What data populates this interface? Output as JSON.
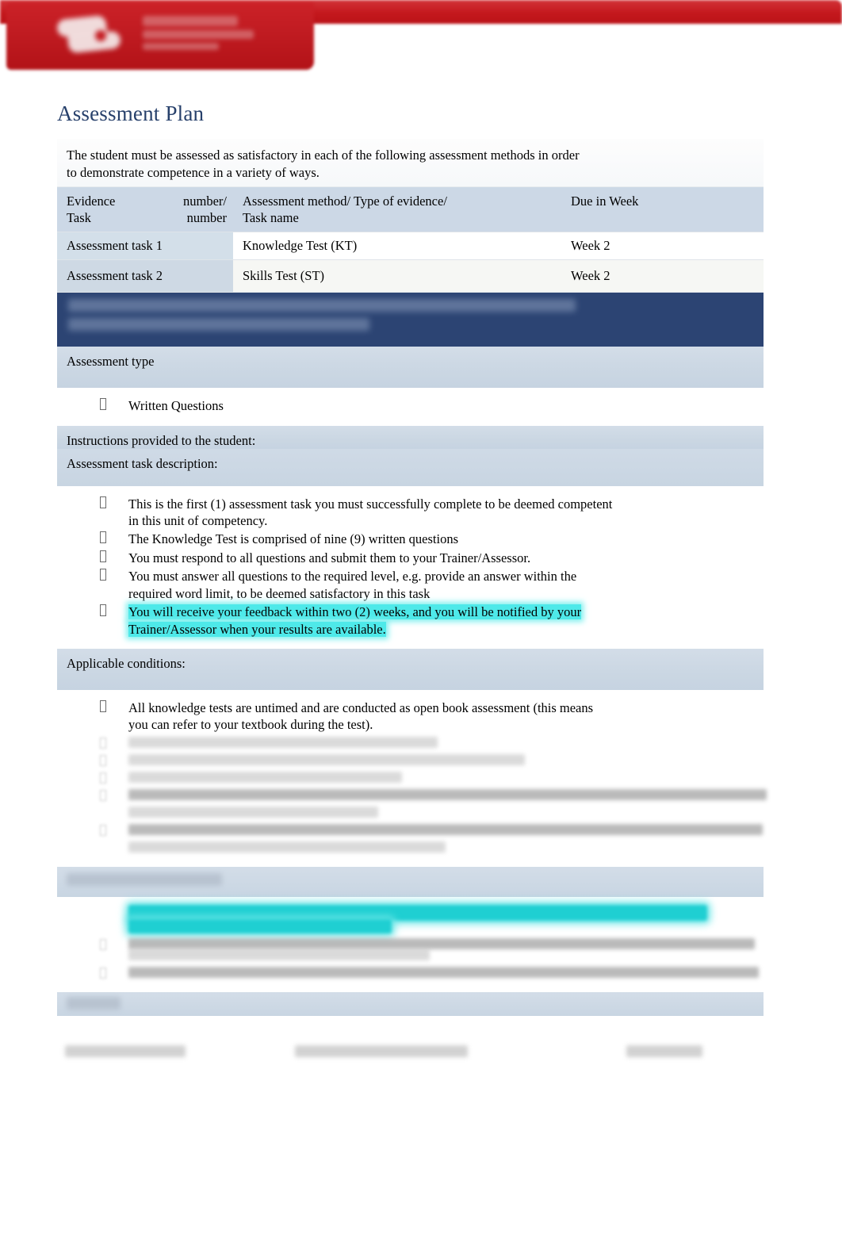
{
  "header": {
    "banner_color": "#c4181d",
    "logo_name": "institution-logo-redacted"
  },
  "page_title": "Assessment Plan",
  "title_color": "#27406b",
  "intro": {
    "line1": "The student must be assessed as satisfactory in each of the following assessment methods in order",
    "line2": "to demonstrate competence in a variety of ways."
  },
  "plan_table": {
    "headers": [
      "Evidence number/ Task number",
      "Assessment method/ Type of evidence/ Task name",
      "Due in Week"
    ],
    "header_parts": {
      "c1_a": "Evidence",
      "c1_b": "number/",
      "c1_c": "Task number",
      "c2_a": "Assessment  method/  Type  of  evidence/",
      "c2_b": "Task name",
      "c3_a": "Due in Week"
    },
    "rows": [
      {
        "evidence": "Assessment task 1",
        "method": "Knowledge Test (KT)",
        "due": "Week 2"
      },
      {
        "evidence": "Assessment task 2",
        "method": "Skills Test (ST)",
        "due": "Week 2"
      }
    ]
  },
  "task_heading": {
    "text": "",
    "note": "obscured-blurred-heading",
    "background": "#2c4473"
  },
  "sections": {
    "assessment_type_label": "Assessment type",
    "assessment_type_items": [
      "Written Questions"
    ],
    "instructions_label": "Instructions provided to the student:",
    "task_description_label": "Assessment task description:",
    "task_description_items": [
      "This is the first (1) assessment task you must successfully complete to be deemed competent in this unit of competency.",
      "The Knowledge Test is comprised of nine (9) written questions",
      "You must respond to all questions and submit them to your Trainer/Assessor.",
      "You must answer all questions to the required level, e.g. provide an answer within the required word limit, to be deemed satisfactory in this task",
      "You will receive   your   feedback    within  two  (2)  weeks,   and  you  will be  notified  by  your Trainer/Assessor     when   your results    are  available."
    ],
    "task_description_items_parts": {
      "item1_l1": "This is the first (1) assessment task you must successfully complete to be deemed competent",
      "item1_l2": "in this unit of competency.",
      "item2": "The Knowledge Test is comprised of nine (9) written questions",
      "item3": "You must respond to all questions and submit them to your Trainer/Assessor.",
      "item4_l1": "You  must  answer  all  questions  to  the  required  level,  e.g.  provide  an  answer  within  the",
      "item4_l2": "required word limit, to be deemed satisfactory in this task",
      "item5_l1": "You   will   receive     your    feedback      within   two   (2)   weeks,    and   you   will  be   notified    by   your",
      "item5_l2": "Trainer/Assessor       when   your results     are   available."
    },
    "applicable_conditions_label": "Applicable conditions:",
    "applicable_conditions_items": [
      "All knowledge tests are untimed and are conducted as open book assessment (this means you can refer to your textbook during the test)."
    ],
    "applicable_conditions_items_parts": {
      "item1_l1": "All knowledge tests are untimed and are conducted as open book assessment (this means",
      "item1_l2": "you can refer to your textbook during the test)."
    },
    "obscured_conditions_note": "additional-conditions-blurred",
    "resubmission_label": "",
    "resubmission_note": "resubmission-section-blurred",
    "location_label": "",
    "location_note": "location-section-blurred"
  },
  "footer": {
    "note": "footer-blurred",
    "cells": [
      "",
      "",
      ""
    ]
  },
  "colors": {
    "band_blue": "#ccd8e4",
    "dark_blue": "#2c4473",
    "highlight_cyan": "#4ee9e9",
    "banner_red": "#c4181d"
  }
}
